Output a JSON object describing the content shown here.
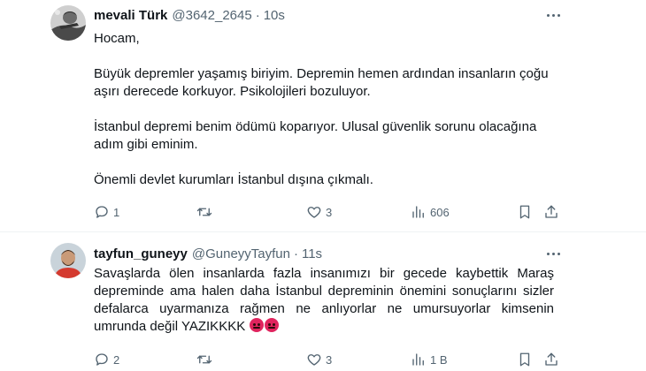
{
  "tweets": [
    {
      "name": "mevali Türk",
      "handle": "@3642_2645",
      "dot": "·",
      "time": "10s",
      "paragraphs": [
        "Hocam,",
        "Büyük depremler yaşamış biriyim. Depremin hemen ardından insanların çoğu aşırı derecede korkuyor. Psikolojileri bozuluyor.",
        "İstanbul depremi benim ödümü koparıyor. Ulusal güvenlik sorunu olacağına adım gibi eminim.",
        "Önemli devlet kurumları İstanbul dışına çıkmalı."
      ],
      "counts": {
        "replies": "1",
        "retweets": "",
        "likes": "3",
        "views": "606"
      }
    },
    {
      "name": "tayfun_guneyy",
      "handle": "@GuneyyTayfun",
      "dot": "·",
      "time": "11s",
      "text": "Savaşlarda ölen insanlarda fazla insanımızı bir gecede kaybettik Maraş depreminde ama halen daha İstanbul depreminin önemini sonuçlarını sizler defalarca uyarmanıza rağmen ne anlıyorlar ne umursuyorlar kimsenin umrunda değil YAZIKKKK",
      "emoji": [
        "angry-face-emoji",
        "angry-face-emoji"
      ],
      "counts": {
        "replies": "2",
        "retweets": "",
        "likes": "3",
        "views": "1 B"
      }
    }
  ],
  "icons": {
    "reply": "reply-icon",
    "retweet": "retweet-icon",
    "like": "heart-icon",
    "views": "views-chart-icon",
    "bookmark": "bookmark-icon",
    "share": "share-icon",
    "more": "more-dots-icon"
  },
  "colors": {
    "text": "#0f1419",
    "secondary": "#536471",
    "divider": "#eff3f4",
    "emoji": "#e0245e"
  }
}
